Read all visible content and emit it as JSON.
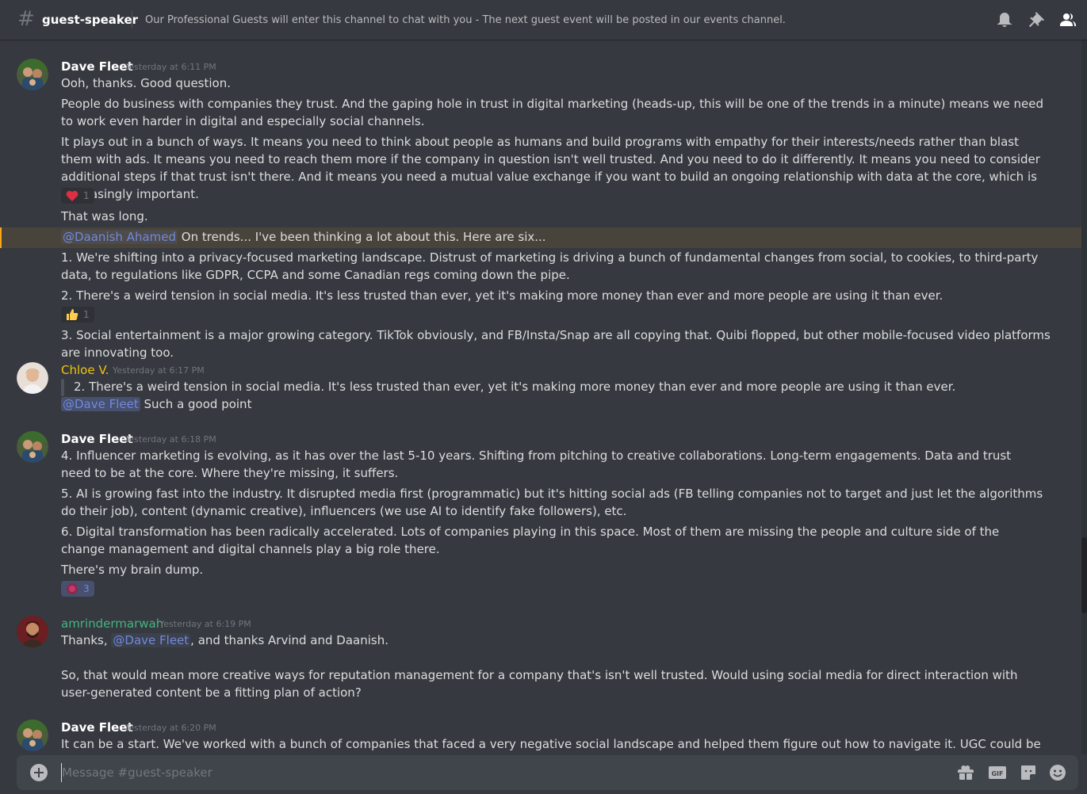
{
  "header": {
    "channel_name": "guest-speaker",
    "topic": "Our Professional Guests will enter this channel to chat with you - The next guest event will be posted in our events channel."
  },
  "colors": {
    "background": "#36393f",
    "author_dave": "#ffffff",
    "author_chloe": "#f1c40f",
    "author_amrinder": "#43b581",
    "mention": "#7289da",
    "highlight": "#faa61a"
  },
  "messages": [
    {
      "author": "Dave Fleet",
      "timestamp": "Yesterday at 6:11 PM",
      "lines": {
        "l1": "Ooh, thanks. Good question.",
        "l2": "People do business with companies they trust. And the gaping hole in trust in digital marketing (heads-up, this will be one of the trends in a minute) means we need to work even harder in digital and especially social channels.",
        "l3": "It plays out in a bunch of ways. It means you need to think about people as humans and build programs with empathy for their interests/needs rather than blast them with ads. It means you need to reach them more if the company in question isn't well trusted. And you need to do it differently. It means you need to consider additional steps if that trust isn't there. And it means you need a mutual value exchange if you want to build an ongoing relationship with data at the core, which is increasingly important.",
        "reaction1": {
          "emoji": "heart",
          "count": "1"
        },
        "l4": "That was long.",
        "l5_mention": "@Daanish Ahamed",
        "l5_text": " On trends... I've been thinking a lot about this. Here are six...",
        "l6": "1. We're shifting into a privacy-focused marketing landscape. Distrust of marketing is driving a bunch of fundamental changes from social, to cookies, to third-party data, to regulations like GDPR, CCPA and some Canadian regs coming down the pipe.",
        "l7": "2. There's a weird tension in social media. It's less trusted than ever, yet it's making more money than ever and more people are using it than ever.",
        "reaction2": {
          "emoji": "thumbs-up",
          "count": "1"
        },
        "l8": "3. Social entertainment is a major growing category. TikTok obviously, and FB/Insta/Snap are all copying that. Quibi flopped, but other mobile-focused video platforms are innovating too."
      }
    },
    {
      "author": "Chloe V.",
      "timestamp": "Yesterday at 6:17 PM",
      "quote": "2. There's a weird tension in social media. It's less trusted than ever, yet it's making more money than ever and more people are using it than ever.",
      "mention": "@Dave Fleet",
      "text": " Such a good point"
    },
    {
      "author": "Dave Fleet",
      "timestamp": "Yesterday at 6:18 PM",
      "lines": {
        "l1": "4. Influencer marketing is evolving, as it has over the last 5-10 years. Shifting from pitching to creative collaborations. Long-term engagements. Data and trust need to be at the core. Where they're missing, it suffers.",
        "l2": "5. AI is growing fast into the industry. It disrupted media first (programmatic) but it's hitting social ads (FB telling companies not to target and just let the algorithms do their job), content (dynamic creative), influencers (we use AI to identify fake followers), etc.",
        "l3": "6. Digital transformation has been radically accelerated. Lots of companies playing in this space. Most of them are missing the people and culture side of the change management and digital channels play a big role there.",
        "l4": "There's my brain dump.",
        "reaction": {
          "emoji": "custom-reaction",
          "count": "3"
        }
      }
    },
    {
      "author": "amrindermarwah",
      "timestamp": "Yesterday at 6:19 PM",
      "l1_pre": "Thanks, ",
      "l1_mention": "@Dave Fleet",
      "l1_post": ", and thanks Arvind and Daanish.",
      "l2": "So, that would mean more creative ways for reputation management for a company that's isn't well trusted. Would using social media for direct interaction with user-generated content be a fitting plan of action?"
    },
    {
      "author": "Dave Fleet",
      "timestamp": "Yesterday at 6:20 PM",
      "l1": "It can be a start. We've worked with a bunch of companies that faced a very negative social landscape and helped them figure out how to navigate it. UGC could be a tough time if you're"
    }
  ],
  "composer": {
    "placeholder": "Message #guest-speaker",
    "icons": [
      "plus-icon",
      "gift-icon",
      "gif-icon",
      "sticker-icon",
      "emoji-icon"
    ]
  }
}
